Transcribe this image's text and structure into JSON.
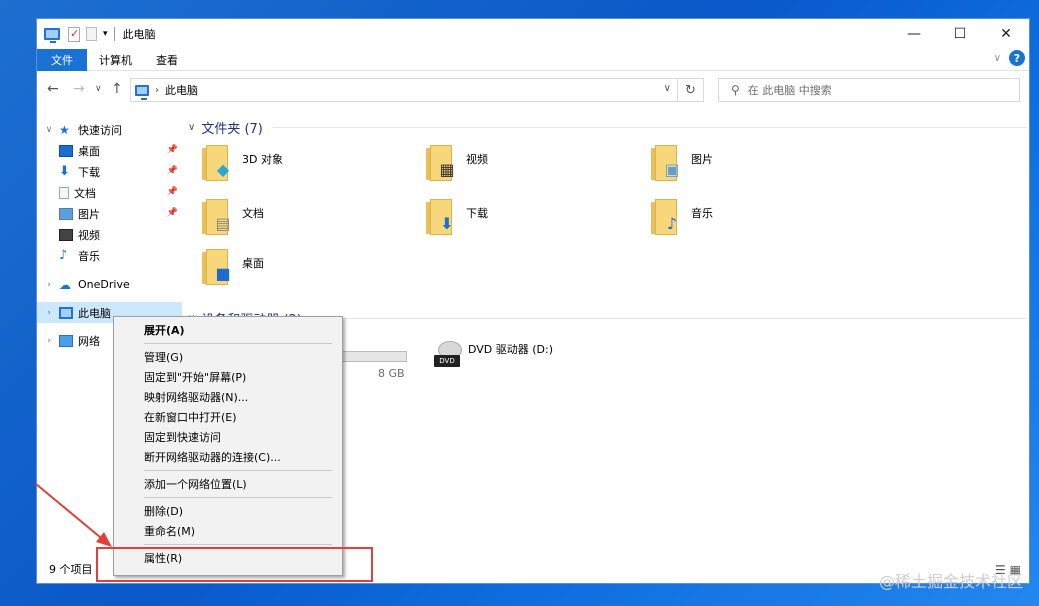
{
  "window": {
    "title": "此电脑",
    "controls": {
      "minimize": "—",
      "maximize": "☐",
      "close": "✕"
    }
  },
  "ribbon": {
    "tabs": [
      "文件",
      "计算机",
      "查看"
    ],
    "help_label": "?"
  },
  "nav": {
    "address_path": "此电脑",
    "search_placeholder": "在 此电脑 中搜索"
  },
  "sidebar": {
    "quick_access": "快速访问",
    "items": [
      {
        "label": "桌面",
        "pinned": true
      },
      {
        "label": "下载",
        "pinned": true
      },
      {
        "label": "文档",
        "pinned": true
      },
      {
        "label": "图片",
        "pinned": true
      },
      {
        "label": "视频",
        "pinned": false
      },
      {
        "label": "音乐",
        "pinned": false
      }
    ],
    "onedrive": "OneDrive",
    "this_pc": "此电脑",
    "network": "网络"
  },
  "content": {
    "folders_group": "文件夹 (7)",
    "folders": [
      {
        "name": "3D 对象",
        "icon": "cube-icon"
      },
      {
        "name": "视频",
        "icon": "film-icon"
      },
      {
        "name": "图片",
        "icon": "picture-icon"
      },
      {
        "name": "文档",
        "icon": "document-icon"
      },
      {
        "name": "下载",
        "icon": "download-arrow-icon"
      },
      {
        "name": "音乐",
        "icon": "music-note-icon"
      },
      {
        "name": "桌面",
        "icon": "desktop-icon"
      }
    ],
    "devices_group": "设备和驱动器 (2)",
    "partial_drive_size": "8 GB",
    "dvd_drive": {
      "label": "DVD 驱动器 (D:)",
      "badge": "DVD"
    }
  },
  "status": {
    "item_count": "9 个项目"
  },
  "context_menu": {
    "items": [
      {
        "label": "展开(A)",
        "bold": true
      },
      {
        "separator": true
      },
      {
        "label": "管理(G)"
      },
      {
        "label": "固定到\"开始\"屏幕(P)"
      },
      {
        "label": "映射网络驱动器(N)..."
      },
      {
        "label": "在新窗口中打开(E)"
      },
      {
        "label": "固定到快速访问"
      },
      {
        "label": "断开网络驱动器的连接(C)..."
      },
      {
        "separator": true
      },
      {
        "label": "添加一个网络位置(L)"
      },
      {
        "separator": true
      },
      {
        "label": "删除(D)"
      },
      {
        "label": "重命名(M)"
      },
      {
        "separator": true
      },
      {
        "label": "属性(R)"
      }
    ]
  },
  "annotation": {
    "highlight_color": "#e0403a"
  },
  "watermark": "@稀土掘金技术社区",
  "colors": {
    "accent": "#1a73d4",
    "group_title": "#1e3287",
    "folder": "#f7d779"
  }
}
